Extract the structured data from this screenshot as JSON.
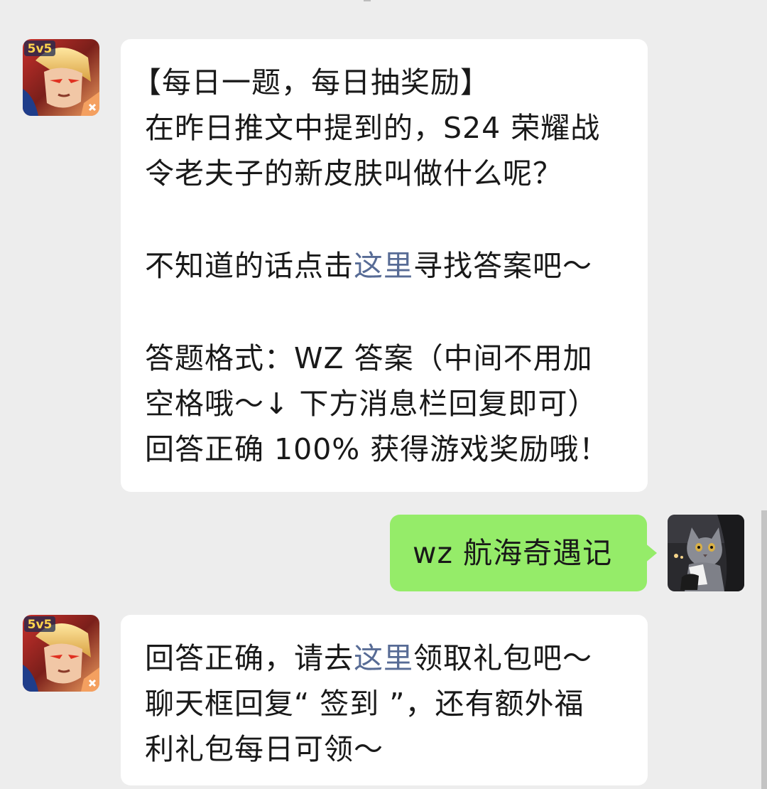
{
  "messages": [
    {
      "sender": "game-account",
      "lines": [
        {
          "text": "【每日一题，每日抽奖励】"
        },
        {
          "text": "在昨日推文中提到的，S24 荣耀战"
        },
        {
          "text": "令老夫子的新皮肤叫做什么呢？"
        },
        {
          "text": ""
        },
        {
          "before": "不知道的话点击",
          "link": "这里",
          "after": "寻找答案吧～"
        },
        {
          "text": ""
        },
        {
          "text": "答题格式：WZ 答案（中间不用加"
        },
        {
          "text": "空格哦～↓ 下方消息栏回复即可）"
        },
        {
          "text": "回答正确 100% 获得游戏奖励哦！"
        }
      ]
    },
    {
      "sender": "user",
      "text": "wz 航海奇遇记"
    },
    {
      "sender": "game-account",
      "lines": [
        {
          "before": "回答正确，请去",
          "link": "这里",
          "after": "领取礼包吧～"
        },
        {
          "text": "聊天框回复“ 签到 ”，还有额外福"
        },
        {
          "text": "利礼包每日可领～"
        }
      ]
    }
  ],
  "avatars": {
    "game_badge": "5v5",
    "game_icon": "hero-portrait-icon",
    "user_icon": "cat-photo-icon"
  },
  "colors": {
    "background": "#ededed",
    "incoming_bubble": "#ffffff",
    "outgoing_bubble": "#95ec69",
    "link": "#576b95",
    "text": "#191919"
  }
}
